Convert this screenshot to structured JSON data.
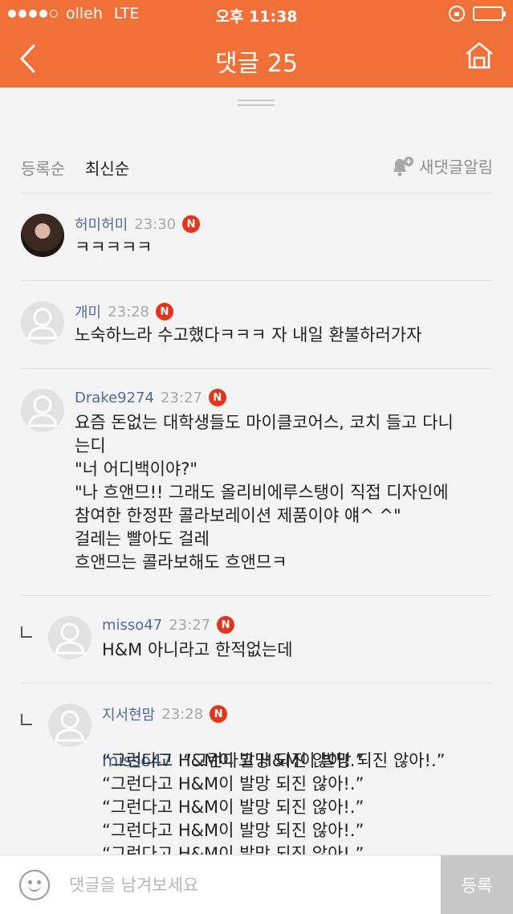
{
  "status": {
    "carrier": "olleh",
    "network": "LTE",
    "time": "오후 11:38"
  },
  "nav": {
    "title": "댓글 25"
  },
  "sort": {
    "by_registration": "등록순",
    "by_latest": "최신순",
    "notify_label": "새댓글알림"
  },
  "comments": [
    {
      "nick": "허미허미",
      "time": "23:30",
      "badge": "N",
      "text": "ㅋㅋㅋㅋㅋ"
    },
    {
      "nick": "개미",
      "time": "23:28",
      "badge": "N",
      "text": "노숙하느라 수고했다ㅋㅋㅋ 자 내일 환불하러가자"
    },
    {
      "nick": "Drake9274",
      "time": "23:27",
      "badge": "N",
      "text": "요즘 돈없는 대학생들도 마이클코어스, 코치 들고 다니\n는디\n\"너 어디백이야?\"\n\"나 흐앤므!! 그래도 올리비에루스탱이 직접 디자인에\n참여한 한정판 콜라보레이션 제품이야 얘^ ^\"\n걸레는 빨아도 걸레\n흐앤므는 콜라보해도 흐앤므ㅋ"
    },
    {
      "nick": "misso47",
      "time": "23:27",
      "badge": "N",
      "text": "H&M 아니라고 한적없는데"
    },
    {
      "nick": "지서현맘",
      "time": "23:28",
      "badge": "N",
      "mention": "misso47",
      "first_line": "“그런다고 H&M이 발망 되진 않아!.”",
      "text": "“그런다고 H&M이 발망 되진 않아!.”\n“그런다고 H&M이 발망 되진 않아!.”\n“그런다고 H&M이 발망 되진 않아!.”\n“그런다고 H&M이 발망 되진 않아!.”\n“그런다고 H&M이 발망 되진 않아!.”"
    }
  ],
  "input": {
    "placeholder": "댓글을 남겨보세요",
    "submit_label": "등록"
  },
  "colors": {
    "accent": "#f07038",
    "badge": "#e8331b",
    "nick": "#556a99"
  }
}
